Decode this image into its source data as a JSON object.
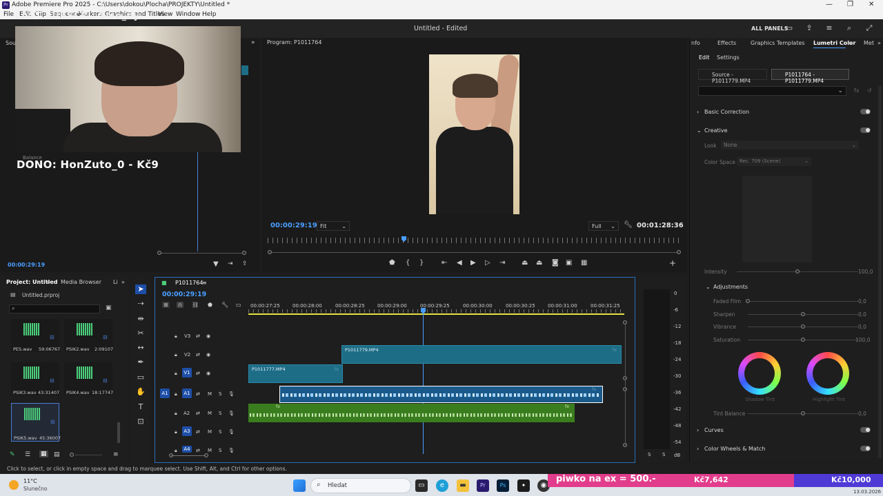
{
  "window": {
    "title": "Adobe Premiere Pro 2025 - C:\\Users\\dokou\\Plocha\\PROJEKTY\\Untitled *",
    "controls": [
      "—",
      "❐",
      "✕"
    ]
  },
  "menu": [
    "File",
    "Edit",
    "Clip",
    "Sequence",
    "Markers",
    "Graphics and Titles",
    "View",
    "Window",
    "Help"
  ],
  "header": {
    "doc_title": "Untitled - Edited",
    "all_panels": "ALL PANELS"
  },
  "overlay": {
    "top_text": "LAST SUBSCRI: Sme_dy",
    "dono_text": "DONO: HonZuto_0 - Kč9"
  },
  "source": {
    "tab": "Sou",
    "timecode": "00:00:29:19",
    "balance_label": "Balance"
  },
  "program": {
    "tab": "Program: P1011764",
    "timecode_left": "00:00:29:19",
    "fit_label": "Fit",
    "full_label": "Full",
    "timecode_right": "00:01:28:36"
  },
  "lumetri": {
    "tabs": [
      "nfo",
      "Effects",
      "Graphics Templates",
      "Lumetri Color",
      "Met"
    ],
    "subtabs": [
      "Edit",
      "Settings"
    ],
    "source_btn": "Source - P1011779.MP4",
    "seq_btn": "P1011764 - P1011779.MP4",
    "sections": {
      "basic": "Basic Correction",
      "creative": "Creative",
      "curves": "Curves",
      "wheels": "Color Wheels & Match"
    },
    "look_label": "Look",
    "look_value": "None",
    "colorspace_label": "Color Space",
    "colorspace_value": "Rec. 709 (Scene)",
    "intensity_label": "Intensity",
    "intensity_value": "100,0",
    "adjustments": "Adjustments",
    "faded_film": {
      "label": "Faded Film",
      "value": "0,0"
    },
    "sharpen": {
      "label": "Sharpen",
      "value": "0,0"
    },
    "vibrance": {
      "label": "Vibrance",
      "value": "0,0"
    },
    "saturation": {
      "label": "Saturation",
      "value": "100,0"
    },
    "shadow_tint": "Shadow Tint",
    "highlight_tint": "Highlight Tint",
    "tint_balance": {
      "label": "Tint Balance",
      "value": "0,0"
    }
  },
  "project": {
    "tabs": [
      "Project: Untitled",
      "Media Browser",
      "Li"
    ],
    "file": "Untitled.prproj",
    "clips": [
      {
        "name": "PES.wav",
        "dur": "59:06767"
      },
      {
        "name": "PSIK2.wav",
        "dur": "2:09107"
      },
      {
        "name": "PSIK3.wav",
        "dur": "43:31407"
      },
      {
        "name": "PSIK4.wav",
        "dur": "18:17747"
      },
      {
        "name": "PSIK5.wav",
        "dur": "45:36007"
      }
    ]
  },
  "timeline": {
    "tab": "P1011764",
    "timecode": "00:00:29:19",
    "ticks": [
      "00:00:27:25",
      "00:00:28:00",
      "00:00:28:25",
      "00:00:29:00",
      "00:00:29:25",
      "00:00:30:00",
      "00:00:30:25",
      "00:00:31:00",
      "00:00:31:25"
    ],
    "tracks": {
      "v3": "V3",
      "v2": "V2",
      "v1": "V1",
      "a1": "A1",
      "a2": "A2",
      "a3": "A3",
      "a4": "A4",
      "m": "M",
      "s": "S"
    },
    "clips": {
      "v2": "P1011779.MP4",
      "v1": "P1011777.MP4",
      "fx": "fx"
    }
  },
  "meter": {
    "scale": [
      "0",
      "-6",
      "-12",
      "-18",
      "-24",
      "-30",
      "-36",
      "-42",
      "-48",
      "-54",
      "dB"
    ],
    "s_left": "S",
    "s_right": "S"
  },
  "status": {
    "hint": "Click to select, or click in empty space and drag to marquee select. Use Shift, Alt, and Ctrl for other options."
  },
  "taskbar": {
    "weather_temp": "11°C",
    "weather_desc": "Slunečno",
    "search": "Hledat",
    "dono_goal": "piwko na ex = 500.-",
    "dono_amount": "Kč7,642",
    "dono_total": "Kč10,000",
    "date": "13.03.2026"
  }
}
